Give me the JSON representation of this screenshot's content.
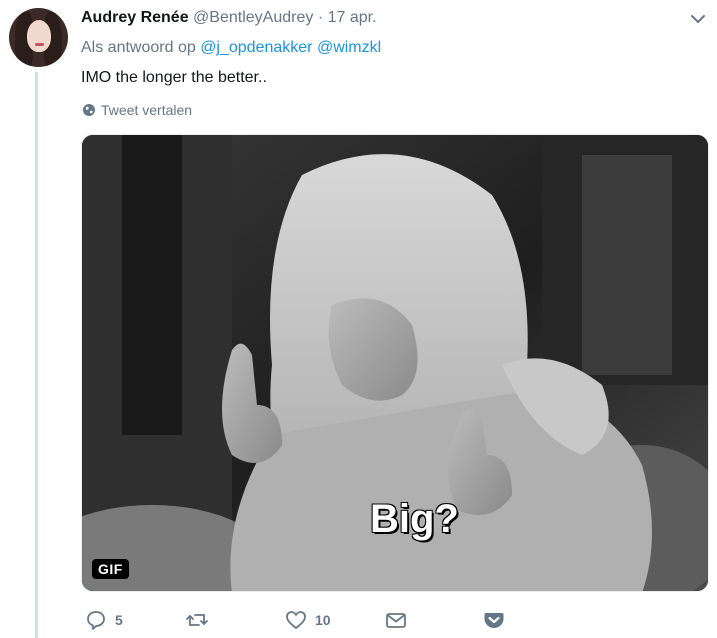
{
  "tweet": {
    "display_name": "Audrey Renée",
    "username": "@BentleyAudrey",
    "separator": "·",
    "timestamp": "17 apr.",
    "reply_prefix": "Als antwoord op",
    "reply_mentions": [
      "@j_opdenakker",
      "@wimzkl"
    ],
    "text": "IMO the longer the better..",
    "translate_label": "Tweet vertalen",
    "media": {
      "badge": "GIF",
      "caption": "Big?"
    },
    "actions": {
      "reply_count": "5",
      "retweet_count": "",
      "like_count": "10"
    }
  },
  "colors": {
    "link": "#1b95e0",
    "secondary_text": "#657786",
    "thread_line": "#c4e4f4"
  },
  "icons": [
    "caret-down-icon",
    "globe-icon",
    "reply-icon",
    "retweet-icon",
    "heart-icon",
    "mail-icon",
    "pocket-icon"
  ]
}
